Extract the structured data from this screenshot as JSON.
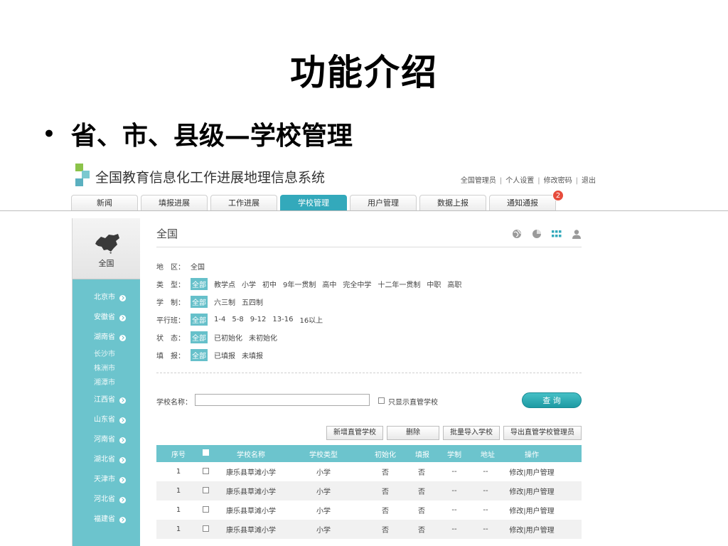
{
  "slide": {
    "title": "功能介绍",
    "bullet_text": "省、市、县级—学校管理"
  },
  "app": {
    "system_title": "全国教育信息化工作进展地理信息系统",
    "user_links": [
      "全国管理员",
      "个人设置",
      "修改密码",
      "退出"
    ],
    "nav_tabs": [
      "新闻",
      "填报进展",
      "工作进展",
      "学校管理",
      "用户管理",
      "数据上报",
      "通知通报"
    ],
    "active_tab": "学校管理",
    "notice_badge": "2",
    "sidebar": {
      "header_label": "全国",
      "items": [
        {
          "label": "北京市"
        },
        {
          "label": "安徽省"
        },
        {
          "label": "湖南省",
          "children": [
            "长沙市",
            "株洲市",
            "湘潭市"
          ]
        },
        {
          "label": "江西省"
        },
        {
          "label": "山东省"
        },
        {
          "label": "河南省"
        },
        {
          "label": "湖北省"
        },
        {
          "label": "天津市"
        },
        {
          "label": "河北省"
        },
        {
          "label": "福建省"
        }
      ]
    },
    "main": {
      "title": "全国",
      "view_icons": [
        "globe-icon",
        "pie-chart-icon",
        "grid-icon",
        "user-icon"
      ],
      "filters": {
        "region": {
          "label": "地　区：",
          "value": "全国"
        },
        "type": {
          "label": "类　型：",
          "options": [
            "全部",
            "教学点",
            "小学",
            "初中",
            "9年一贯制",
            "高中",
            "完全中学",
            "十二年一贯制",
            "中职",
            "高职"
          ],
          "selected": "全部"
        },
        "system": {
          "label": "学　制：",
          "options": [
            "全部",
            "六三制",
            "五四制"
          ],
          "selected": "全部"
        },
        "classes": {
          "label": "平行班：",
          "options": [
            "全部",
            "1-4",
            "5-8",
            "9-12",
            "13-16",
            "16以上"
          ],
          "selected": "全部"
        },
        "status": {
          "label": "状　态：",
          "options": [
            "全部",
            "已初始化",
            "未初始化"
          ],
          "selected": "全部"
        },
        "report": {
          "label": "填　报：",
          "options": [
            "全部",
            "已填报",
            "未填报"
          ],
          "selected": "全部"
        }
      },
      "search": {
        "label": "学校名称：",
        "input_value": "",
        "input_placeholder": "",
        "checkbox_label": "只显示直管学校",
        "button_label": "查 询"
      },
      "actions": [
        "新增直管学校",
        "删除",
        "批量导入学校",
        "导出直管学校管理员"
      ],
      "table": {
        "headers": [
          "序号",
          "学校名称",
          "学校类型",
          "初始化",
          "填报",
          "学制",
          "地址",
          "操作"
        ],
        "rows": [
          {
            "no": "1",
            "name": "康乐县草滩小学",
            "type": "小学",
            "init": "否",
            "report": "否",
            "system": "--",
            "address": "--",
            "ops": "修改|用户管理"
          },
          {
            "no": "1",
            "name": "康乐县草滩小学",
            "type": "小学",
            "init": "否",
            "report": "否",
            "system": "--",
            "address": "--",
            "ops": "修改|用户管理"
          },
          {
            "no": "1",
            "name": "康乐县草滩小学",
            "type": "小学",
            "init": "否",
            "report": "否",
            "system": "--",
            "address": "--",
            "ops": "修改|用户管理"
          },
          {
            "no": "1",
            "name": "康乐县草滩小学",
            "type": "小学",
            "init": "否",
            "report": "否",
            "system": "--",
            "address": "--",
            "ops": "修改|用户管理"
          }
        ]
      }
    },
    "colors": {
      "accent": "#33a9bb",
      "sidebar": "#6cc4cd",
      "badge": "#e74c3c"
    }
  }
}
